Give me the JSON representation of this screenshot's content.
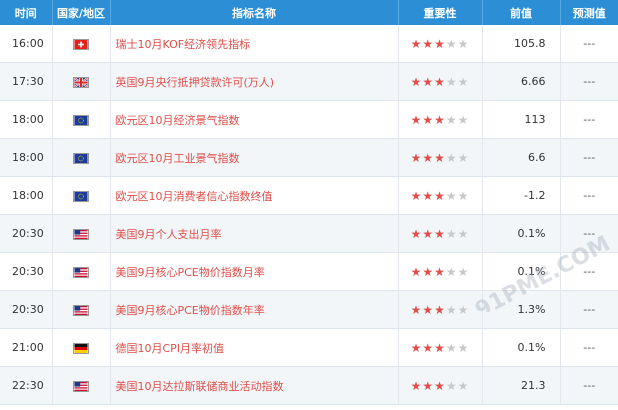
{
  "headers": [
    "时间",
    "国家/地区",
    "指标名称",
    "重要性",
    "前值",
    "预测值"
  ],
  "rows": [
    {
      "time": "16:00",
      "flag": "ch",
      "name": "瑞士10月KOF经济领先指标",
      "stars": 3,
      "prev": "105.8",
      "forecast": "---"
    },
    {
      "time": "17:30",
      "flag": "gb",
      "name": "英国9月央行抵押贷款许可(万人)",
      "stars": 3,
      "prev": "6.66",
      "forecast": "---"
    },
    {
      "time": "18:00",
      "flag": "eu",
      "name": "欧元区10月经济景气指数",
      "stars": 3,
      "prev": "113",
      "forecast": "---"
    },
    {
      "time": "18:00",
      "flag": "eu",
      "name": "欧元区10月工业景气指数",
      "stars": 3,
      "prev": "6.6",
      "forecast": "---"
    },
    {
      "time": "18:00",
      "flag": "eu",
      "name": "欧元区10月消费者信心指数终值",
      "stars": 3,
      "prev": "-1.2",
      "forecast": "---"
    },
    {
      "time": "20:30",
      "flag": "us",
      "name": "美国9月个人支出月率",
      "stars": 3,
      "prev": "0.1%",
      "forecast": "---"
    },
    {
      "time": "20:30",
      "flag": "us",
      "name": "美国9月核心PCE物价指数月率",
      "stars": 3,
      "prev": "0.1%",
      "forecast": "---"
    },
    {
      "time": "20:30",
      "flag": "us",
      "name": "美国9月核心PCE物价指数年率",
      "stars": 3,
      "prev": "1.3%",
      "forecast": "---"
    },
    {
      "time": "21:00",
      "flag": "de",
      "name": "德国10月CPI月率初值",
      "stars": 3,
      "prev": "0.1%",
      "forecast": "---"
    },
    {
      "time": "22:30",
      "flag": "us",
      "name": "美国10月达拉斯联储商业活动指数",
      "stars": 3,
      "prev": "21.3",
      "forecast": "---"
    }
  ],
  "watermark": "91PME.COM",
  "colors": {
    "header": "#2c8fd6",
    "indicator": "#e04e49",
    "star_on": "#e04e49",
    "star_off": "#c8c8c8"
  }
}
